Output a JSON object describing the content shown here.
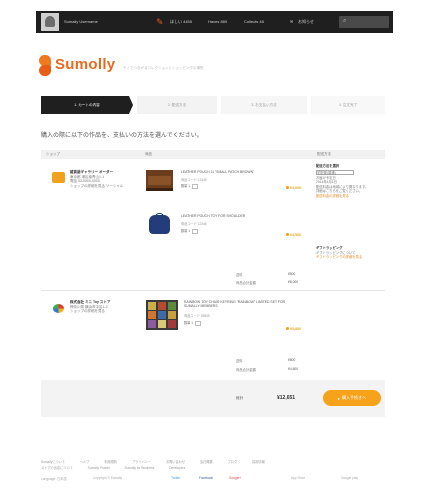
{
  "header": {
    "user_name": "Sumally Username",
    "menu_items": [
      "ほしい 4455",
      "Haves 889",
      "Collects 48"
    ],
    "notice_label": "お知らせ",
    "search_placeholder": "キーワードで検索"
  },
  "logo": {
    "brand": "Sumolly",
    "tagline": "モノでつながるコレクションとショッピングの場所"
  },
  "steps": [
    "1. カートの内容",
    "2. 配送方法",
    "3. お支払い方法",
    "4. 注文完了"
  ],
  "instruction": "購入の際に以下の作品を、支払いの方法を選んでください。",
  "table_headers": {
    "shop": "ショップ",
    "item": "商品",
    "delivery": "配送方法"
  },
  "shops": [
    {
      "name": "雑貨屋ギャラリー オーダー",
      "details": [
        "東京都 港区南青山1-1",
        "電話 03-0000-0000",
        "ショップの詳細を見る ソーシャル"
      ],
      "icon_color": "#f2a11f",
      "items": [
        {
          "title": "LEATHER POUCH 11 \"SMALL PATCH BROWN\"",
          "sub": "商品コード 12345",
          "qty_label": "数量 1",
          "price": "¥3,000"
        },
        {
          "title": "LEATHER POUCH TOY FOR SHOULDER",
          "sub": "商品コード 12346",
          "qty_label": "数量 1",
          "price": "¥4,500"
        }
      ],
      "subtotal_label": "送料",
      "subtotal_value": "¥500",
      "total_label": "商品合計金額",
      "total_value": "¥8,000"
    },
    {
      "name": "株式会社 ミニ Toy ストア",
      "details": [
        "神奈川県 横浜市中区1-2",
        "ショップの詳細を見る"
      ],
      "icon_color": "#3b6fd0",
      "items": [
        {
          "title": "RAINBOW TOY CHAIR KEYRING \"RAINBOW\" LIMITED SET FOR SUMALLY MEMBERS",
          "sub": "商品コード 55555",
          "qty_label": "数量 1",
          "price": "¥3,800"
        }
      ],
      "subtotal_label": "送料",
      "subtotal_value": "¥800",
      "total_label": "商品合計金額",
      "total_value": "¥4,600"
    }
  ],
  "sidebar": {
    "section1_title": "配送方法を選択",
    "select_value": "宅配便(普通)",
    "section1_lines": [
      "お届け予定日",
      "2014年4月1日",
      "配送料金は地域により異なります。",
      "詳細はこちらをご覧ください。"
    ],
    "section1_link": "配送料金の詳細を見る",
    "section2_title": "ギフトラッピング",
    "section2_line": "ギフトラッピングについて",
    "section2_link": "ギフトラッピングの詳細を見る"
  },
  "total": {
    "label": "総計",
    "amount": "¥12,651",
    "buy_button": "購入手続きへ"
  },
  "footer": {
    "links": [
      "Sumallyについて",
      "ヘルプ",
      "利用規約",
      "プライバシー",
      "お問い合わせ",
      "会社概要",
      "ブログ",
      "採用情報",
      "ストアの出店について",
      "Sumally Pocket",
      "Sumally for Business",
      "Developers"
    ],
    "bottom_items": [
      "Language: 日本語",
      "Copyright © Sumally",
      "Twitter",
      "Facebook",
      "Google+",
      "App Store",
      "Google play"
    ]
  },
  "colors": {
    "accent": "#f6a21b",
    "brand": "#e86a1e",
    "topbar": "#1f1f1f"
  }
}
